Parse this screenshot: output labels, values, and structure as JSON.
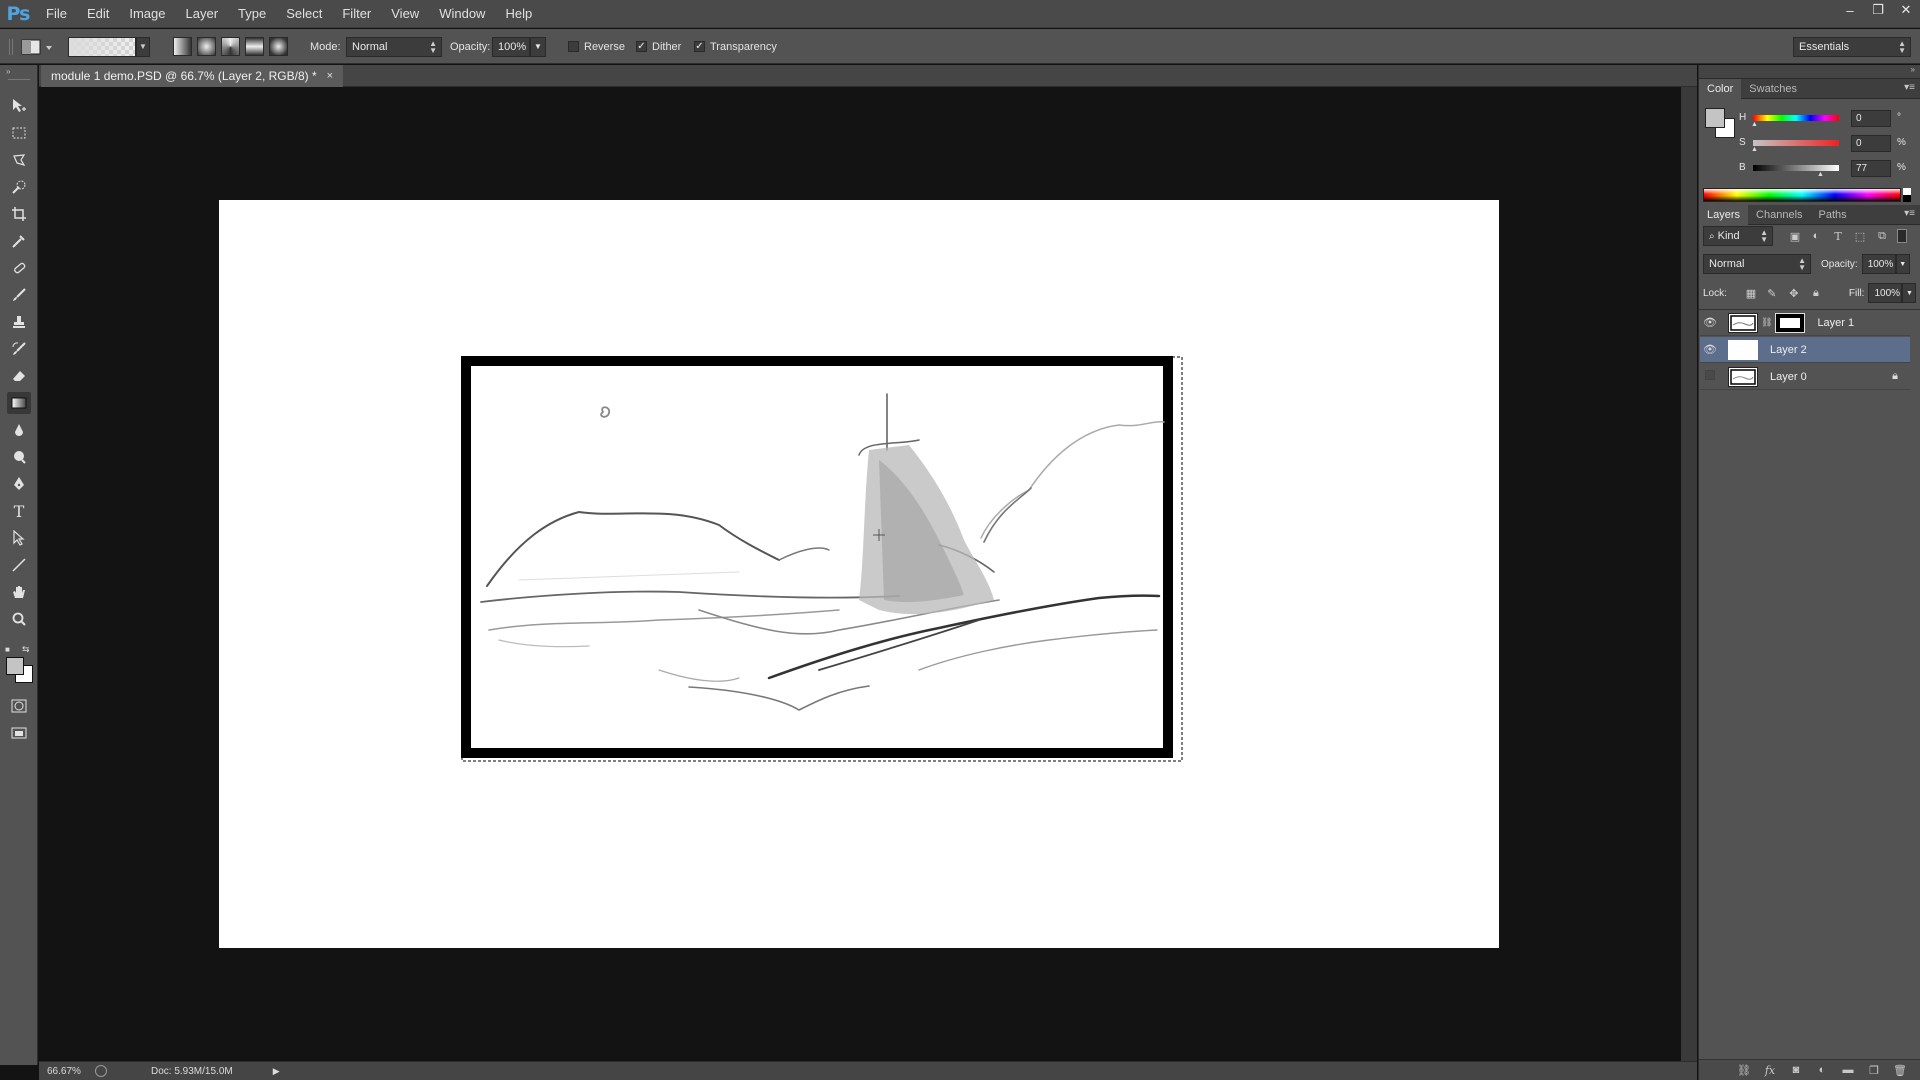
{
  "app": {
    "logo": "Ps"
  },
  "menu": [
    "File",
    "Edit",
    "Image",
    "Layer",
    "Type",
    "Select",
    "Filter",
    "View",
    "Window",
    "Help"
  ],
  "window_controls": {
    "minimize": "–",
    "restore": "❐",
    "close": "✕"
  },
  "options_bar": {
    "mode_label": "Mode:",
    "mode_value": "Normal",
    "opacity_label": "Opacity:",
    "opacity_value": "100%",
    "reverse_label": "Reverse",
    "reverse_checked": false,
    "dither_label": "Dither",
    "dither_checked": true,
    "transparency_label": "Transparency",
    "transparency_checked": true,
    "workspace": "Essentials"
  },
  "document": {
    "tab_title": "module 1 demo.PSD @ 66.7% (Layer 2, RGB/8) *",
    "close": "×"
  },
  "color_panel": {
    "tabs": [
      "Color",
      "Swatches"
    ],
    "h_label": "H",
    "h_value": "0",
    "h_unit": "°",
    "s_label": "S",
    "s_value": "0",
    "s_unit": "%",
    "b_label": "B",
    "b_value": "77",
    "b_unit": "%",
    "foreground": "#c4c4c4",
    "background": "#ffffff"
  },
  "layers_panel": {
    "tabs": [
      "Layers",
      "Channels",
      "Paths"
    ],
    "filter_kind": "Kind",
    "blend_mode": "Normal",
    "opacity_label": "Opacity:",
    "opacity_value": "100%",
    "lock_label": "Lock:",
    "fill_label": "Fill:",
    "fill_value": "100%",
    "layers": [
      {
        "name": "Layer 1",
        "visible": true,
        "selected": false,
        "has_mask": true,
        "locked": false
      },
      {
        "name": "Layer 2",
        "visible": true,
        "selected": true,
        "has_mask": false,
        "locked": false
      },
      {
        "name": "Layer 0",
        "visible": false,
        "selected": false,
        "has_mask": false,
        "locked": true
      }
    ]
  },
  "status": {
    "zoom": "66.67%",
    "doc_size": "Doc: 5.93M/15.0M"
  },
  "colors": {
    "selection_highlight": "#5c6e8c",
    "ps_blue": "#4fa3e0"
  }
}
